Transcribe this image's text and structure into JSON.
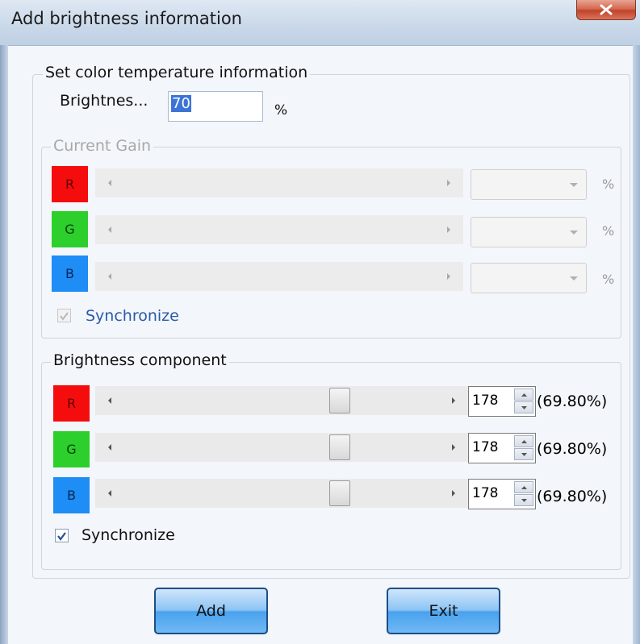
{
  "window": {
    "title": "Add brightness information"
  },
  "color_temp": {
    "group_label": "Set color temperature information",
    "brightness_label": "Brightnes...",
    "brightness_value": "70",
    "brightness_unit": "%"
  },
  "current_gain": {
    "group_label": "Current Gain",
    "channels": [
      {
        "label": "R",
        "unit": "%"
      },
      {
        "label": "G",
        "unit": "%"
      },
      {
        "label": "B",
        "unit": "%"
      }
    ],
    "sync_label": "Synchronize",
    "sync_checked": true,
    "enabled": false
  },
  "brightness_component": {
    "group_label": "Brightness component",
    "channels": [
      {
        "label": "R",
        "value": "178",
        "percent": "(69.80%)",
        "level": 0.698
      },
      {
        "label": "G",
        "value": "178",
        "percent": "(69.80%)",
        "level": 0.698
      },
      {
        "label": "B",
        "value": "178",
        "percent": "(69.80%)",
        "level": 0.698
      }
    ],
    "sync_label": "Synchronize",
    "sync_checked": true
  },
  "buttons": {
    "add": "Add",
    "exit": "Exit"
  },
  "colors": {
    "red": "#f50d0d",
    "green": "#2ccf2c",
    "blue": "#1e8df5",
    "button_blue": "#4aa2ee"
  },
  "icons": [
    "close-icon",
    "scroll-left-icon",
    "scroll-right-icon",
    "dropdown-arrow-icon",
    "spin-up-icon",
    "spin-down-icon",
    "checkmark-icon"
  ]
}
